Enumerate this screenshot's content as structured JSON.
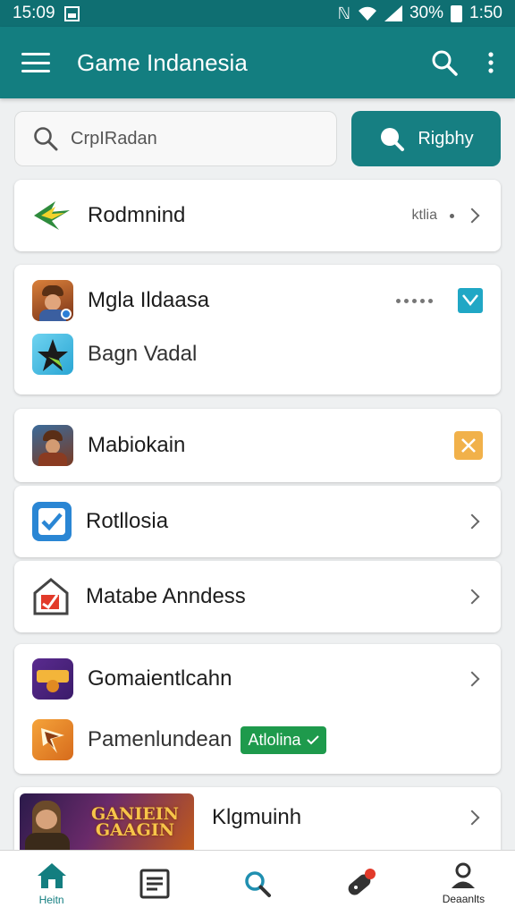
{
  "status": {
    "time": "15:09",
    "battery": "30%",
    "clock_right": "1:50"
  },
  "appbar": {
    "title": "Game Indanesia"
  },
  "search": {
    "placeholder": "CrpIRadan",
    "button_label": "Rigbhy"
  },
  "rows": {
    "r1": {
      "label": "Rodmnind",
      "meta": "ktlia"
    },
    "r2a": {
      "label": "Mgla Ildaasa"
    },
    "r2b": {
      "label": "Bagn Vadal"
    },
    "r3": {
      "label": "Mabiokain"
    },
    "r4": {
      "label": "Rotllosia"
    },
    "r5": {
      "label": "Matabe Anndess"
    },
    "r6a": {
      "label": "Gomaientlcahn"
    },
    "r6b": {
      "label": "Pamenlundean",
      "badge": "Atlolina"
    },
    "r7": {
      "label": "Klgmuinh",
      "banner_text": "GANIEIN GAAGIN"
    }
  },
  "nav": [
    {
      "label": "Heitn",
      "icon": "home-icon"
    },
    {
      "label": "",
      "icon": "news-icon"
    },
    {
      "label": "",
      "icon": "search-icon"
    },
    {
      "label": "",
      "icon": "game-icon"
    },
    {
      "label": "Deaanlts",
      "icon": "profile-icon"
    }
  ],
  "colors": {
    "primary": "#137e80",
    "status_bar": "#0f6f72",
    "accent_badge": "#1e9a4c",
    "check_tile": "#20a7c5",
    "x_tile": "#f1b14a"
  }
}
